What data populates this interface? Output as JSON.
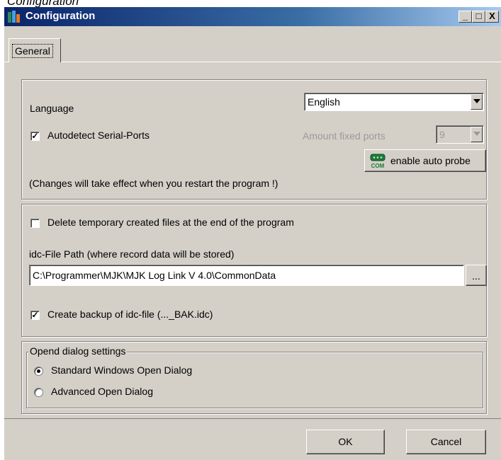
{
  "caption_above": "Configuration",
  "window": {
    "title": "Configuration",
    "minimize": "_",
    "maximize": "□",
    "close": "X"
  },
  "tabs": [
    {
      "label": "General"
    }
  ],
  "general": {
    "language_label": "Language",
    "language_value": "English",
    "autodetect_label": "Autodetect Serial-Ports",
    "autodetect_checked": true,
    "amount_fixed_ports_label": "Amount fixed ports",
    "amount_fixed_ports_value": "9",
    "auto_probe_button": "enable auto probe",
    "com_icon_text": "COM",
    "restart_note": "(Changes will take effect when you restart the program !)",
    "delete_temp_label": "Delete temporary created files at the end of the program",
    "delete_temp_checked": false,
    "idc_path_label": "idc-File Path (where record data will be stored)",
    "idc_path_value": "C:\\Programmer\\MJK\\MJK Log Link V 4.0\\CommonData",
    "browse_button": "...",
    "backup_label": "Create backup of idc-file (..._BAK.idc)",
    "backup_checked": true,
    "open_dialog_legend": "Opend dialog settings",
    "radio_standard": "Standard Windows Open Dialog",
    "radio_advanced": "Advanced Open Dialog",
    "radio_selected": "standard"
  },
  "footer": {
    "ok": "OK",
    "cancel": "Cancel"
  },
  "colors": {
    "titlebar_start": "#0a246a",
    "titlebar_end": "#a6caf0",
    "face": "#d4d0c8"
  }
}
